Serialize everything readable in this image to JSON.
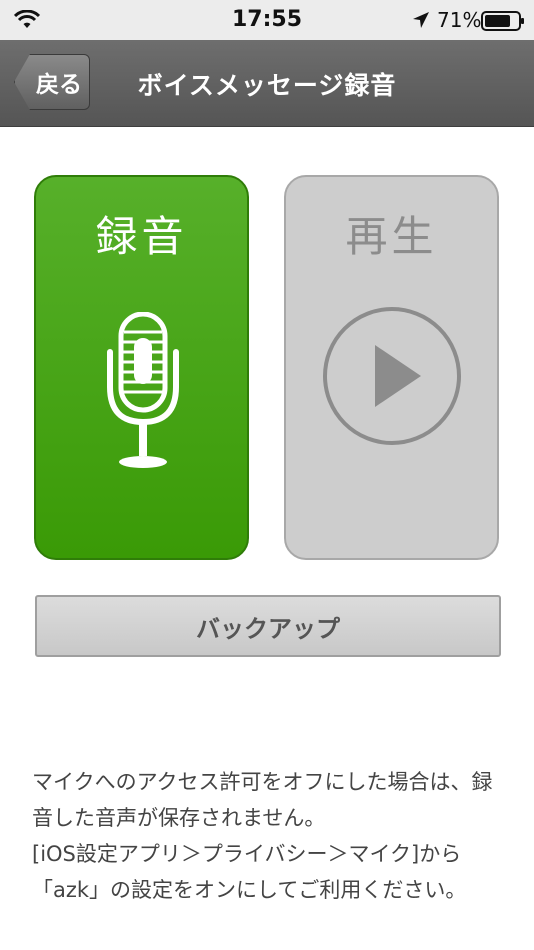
{
  "status_bar": {
    "time": "17:55",
    "battery_percent": "71%",
    "icons": [
      "wifi-icon",
      "location-arrow-icon",
      "battery-icon"
    ]
  },
  "nav": {
    "back_label": "戻る",
    "title": "ボイスメッセージ録音"
  },
  "record": {
    "label": "録音",
    "icon": "microphone-icon",
    "color": "#4aa51c"
  },
  "play": {
    "label": "再生",
    "icon": "play-icon",
    "color": "#cdcdcd"
  },
  "backup": {
    "label": "バックアップ"
  },
  "info": {
    "lines": [
      "マイクへのアクセス許可をオフにした場合は、録",
      "音した音声が保存されません。",
      "[iOS設定アプリ＞プライバシー＞マイク]から",
      "「azk」の設定をオンにしてご利用ください。"
    ]
  }
}
